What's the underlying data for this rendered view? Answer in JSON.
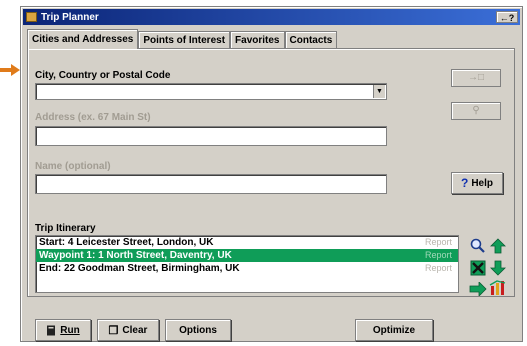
{
  "window": {
    "title": "Trip Planner",
    "title_button": "←?"
  },
  "tabs": [
    {
      "label": "Cities and Addresses"
    },
    {
      "label": "Points of Interest"
    },
    {
      "label": "Favorites"
    },
    {
      "label": "Contacts"
    }
  ],
  "form": {
    "city_label": "City, Country or Postal Code",
    "city_value": "",
    "address_label": "Address (ex. 67 Main St)",
    "address_value": "",
    "name_label": "Name (optional)",
    "name_value": ""
  },
  "help_label": "Help",
  "itinerary": {
    "label": "Trip Itinerary",
    "rows": [
      {
        "text": "Start: 4 Leicester Street, London, UK",
        "status": "Report",
        "selected": false
      },
      {
        "text": "Waypoint 1: 1 North Street, Daventry, UK",
        "status": "Report",
        "selected": true
      },
      {
        "text": "End: 22 Goodman Street, Birmingham, UK",
        "status": "Report",
        "selected": false
      }
    ]
  },
  "bottom_buttons": {
    "run": "Run",
    "clear": "Clear",
    "options": "Options",
    "optimize": "Optimize"
  },
  "icons": [
    "zoom-icon",
    "move-up-icon",
    "delete-icon",
    "move-down-icon",
    "add-icon",
    "reverse-route-icon"
  ],
  "colors": {
    "selection": "#0f9d58",
    "title_bar": "#0b2476",
    "arrow": "#e07b1a"
  }
}
